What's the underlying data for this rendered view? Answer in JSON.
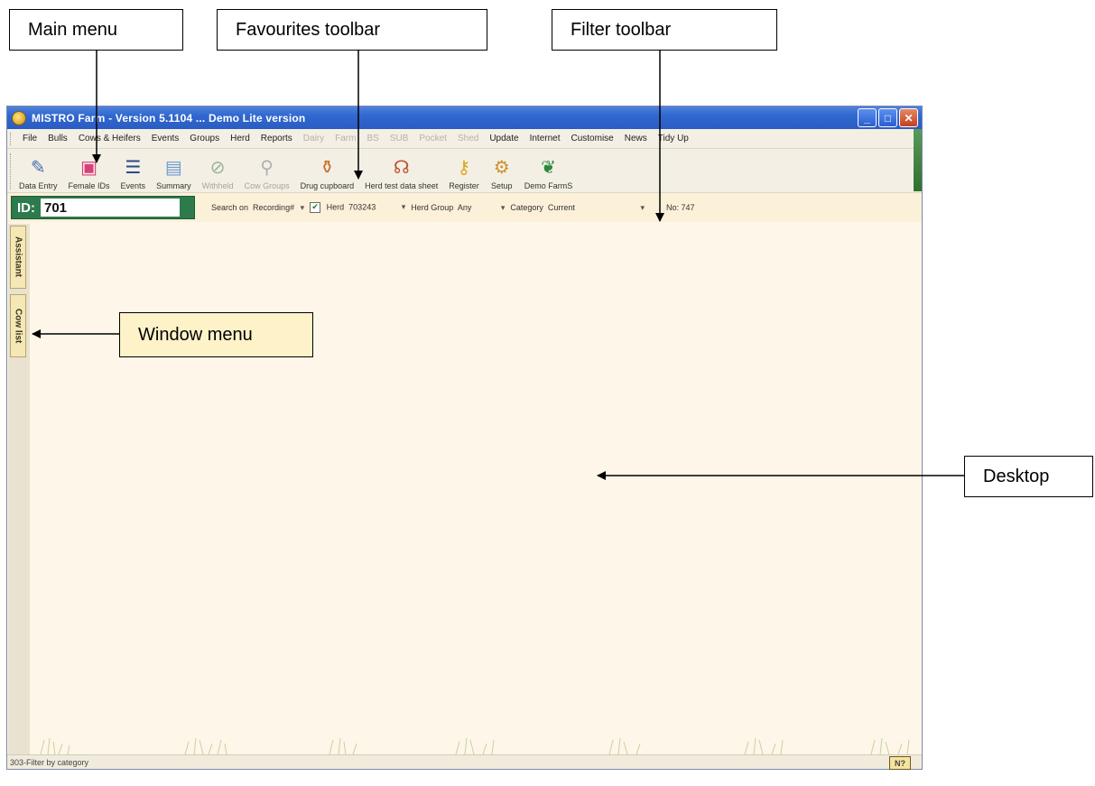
{
  "callouts": {
    "main_menu": "Main menu",
    "favourites_toolbar": "Favourites toolbar",
    "filter_toolbar": "Filter toolbar",
    "window_menu": "Window menu",
    "desktop": "Desktop"
  },
  "window": {
    "title": "MISTRO Farm - Version 5.1104 ... Demo Lite version",
    "buttons": {
      "minimize": "_",
      "maximize": "□",
      "close": "✕"
    }
  },
  "menu": [
    "File",
    "Bulls",
    "Cows & Heifers",
    "Events",
    "Groups",
    "Herd",
    "Reports",
    "Dairy",
    "Farm",
    "BS",
    "SUB",
    "Pocket",
    "Shed",
    "Update",
    "Internet",
    "Customise",
    "News",
    "Tidy Up"
  ],
  "menu_dim": [
    false,
    false,
    false,
    false,
    false,
    false,
    false,
    true,
    true,
    true,
    true,
    true,
    true,
    false,
    false,
    false,
    false,
    false
  ],
  "favourites": [
    {
      "label": "Data Entry",
      "icon": "pencil-icon",
      "glyph": "✎",
      "color": "#4a6fb0",
      "dim": false
    },
    {
      "label": "Female IDs",
      "icon": "cow-tag-icon",
      "glyph": "▣",
      "color": "#d9407a",
      "dim": false
    },
    {
      "label": "Events",
      "icon": "list-icon",
      "glyph": "☰",
      "color": "#2a4a8a",
      "dim": false
    },
    {
      "label": "Summary",
      "icon": "document-icon",
      "glyph": "▤",
      "color": "#6a9ad0",
      "dim": false
    },
    {
      "label": "Withheld",
      "icon": "no-entry-icon",
      "glyph": "⊘",
      "color": "#9ab09a",
      "dim": true
    },
    {
      "label": "Cow Groups",
      "icon": "groups-icon",
      "glyph": "⚲",
      "color": "#b0b0b0",
      "dim": true
    },
    {
      "label": "Drug cupboard",
      "icon": "bottle-icon",
      "glyph": "⚱",
      "color": "#c8702a",
      "dim": false
    },
    {
      "label": "Herd test data sheet",
      "icon": "herd-test-icon",
      "glyph": "☊",
      "color": "#c05030",
      "dim": false
    },
    {
      "label": "Register",
      "icon": "key-icon",
      "glyph": "⚷",
      "color": "#d8a820",
      "dim": false
    },
    {
      "label": "Setup",
      "icon": "setup-icon",
      "glyph": "⚙",
      "color": "#d0902a",
      "dim": false
    },
    {
      "label": "Demo FarmS",
      "icon": "farm-icon",
      "glyph": "❦",
      "color": "#2a8a3a",
      "dim": false
    }
  ],
  "filter": {
    "id_label": "ID:",
    "id_value": "701",
    "search_on_label": "Search on",
    "search_on_value": "Recording#",
    "herd_checked": "✔",
    "herd_label": "Herd",
    "herd_value": "703243",
    "herd_group_label": "Herd Group",
    "herd_group_value": "Any",
    "category_label": "Category",
    "category_value": "Current",
    "count_label": "No: 747",
    "dropdown_arrow": "▾"
  },
  "sidetabs": [
    "Assistant",
    "Cow list"
  ],
  "status": {
    "text": "303-Filter by category",
    "help": "N?"
  }
}
